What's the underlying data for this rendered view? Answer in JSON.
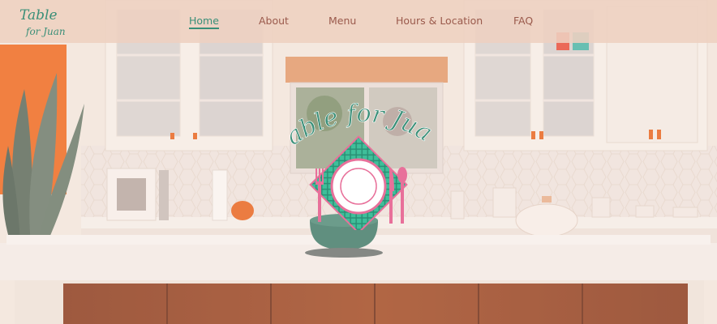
{
  "brand": {
    "logo_text_line1": "Table",
    "logo_text_line2": "for Juan",
    "hero_text": "Table for Juan"
  },
  "nav": {
    "items": [
      {
        "label": "Home",
        "active": true
      },
      {
        "label": "About",
        "active": false
      },
      {
        "label": "Menu",
        "active": false
      },
      {
        "label": "Hours & Location",
        "active": false
      },
      {
        "label": "FAQ",
        "active": false
      }
    ]
  },
  "colors": {
    "accent": "#3a8f78",
    "nav_text": "#9a5a4c",
    "navbar_bg": "#eed0c0",
    "plate_pink": "#e8709a"
  },
  "icons": {
    "fork": "fork-icon",
    "plate": "plate-icon",
    "knife": "knife-icon",
    "spoon": "spoon-icon"
  }
}
